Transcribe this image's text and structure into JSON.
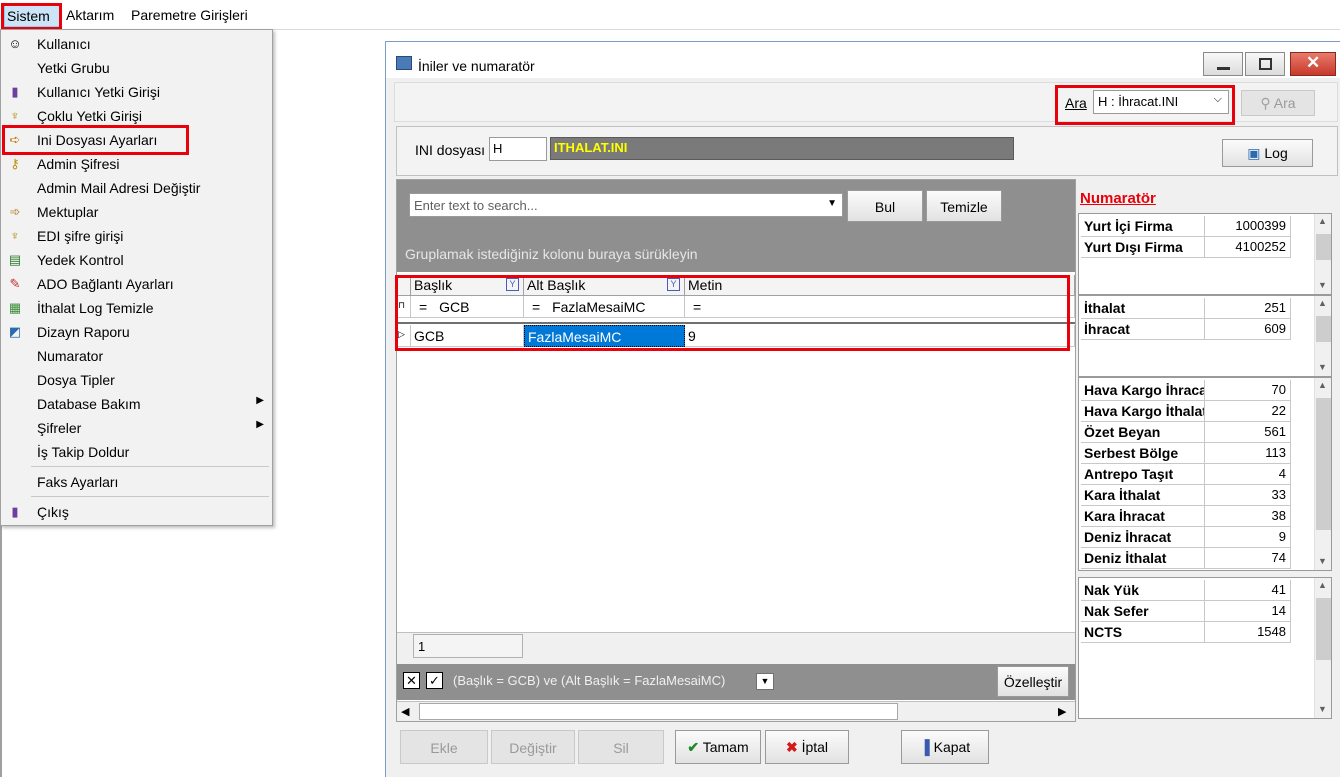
{
  "menubar": {
    "items": [
      "Sistem",
      "Aktarım",
      "Paremetre Girişleri"
    ]
  },
  "sistem_menu": {
    "items": [
      {
        "label": "Kullanıcı",
        "icon": "user-icon"
      },
      {
        "label": "Yetki Grubu",
        "icon": ""
      },
      {
        "label": "Kullanıcı Yetki Girişi",
        "icon": "key-icon"
      },
      {
        "label": "Çoklu Yetki Girişi",
        "icon": "keys-icon"
      },
      {
        "label": "Ini Dosyası  Ayarları",
        "icon": "settings-file-icon"
      },
      {
        "label": "Admin Şifresi",
        "icon": "key-icon"
      },
      {
        "label": "Admin Mail Adresi Değiştir",
        "icon": ""
      },
      {
        "label": "Mektuplar",
        "icon": "letter-icon"
      },
      {
        "label": "EDI şifre girişi",
        "icon": "keys-icon"
      },
      {
        "label": "Yedek Kontrol",
        "icon": "backup-icon"
      },
      {
        "label": "ADO Bağlantı Ayarları",
        "icon": "connection-icon"
      },
      {
        "label": "İthalat Log Temizle",
        "icon": "log-icon"
      },
      {
        "label": "Dizayn Raporu",
        "icon": "report-icon"
      },
      {
        "label": "Numarator",
        "icon": ""
      },
      {
        "label": "Dosya Tipler",
        "icon": ""
      },
      {
        "label": "Database Bakım",
        "icon": ""
      },
      {
        "label": "Şifreler",
        "icon": ""
      },
      {
        "label": "İş Takip Doldur",
        "icon": ""
      },
      {
        "label": "Faks Ayarları",
        "icon": ""
      },
      {
        "label": "Çıkış",
        "icon": "exit-icon"
      }
    ]
  },
  "window": {
    "title": "İniler ve numaratör",
    "search": {
      "label": "Ara",
      "value": "H : İhracat.INI",
      "button": "Ara"
    },
    "ini": {
      "label": "INI dosyası",
      "code": "H",
      "name": "ITHALAT.INI"
    },
    "log_button": "Log",
    "grid_search": {
      "placeholder": "Enter text to search...",
      "find_button": "Bul",
      "clear_button": "Temizle"
    },
    "group_hint": "Gruplamak istediğiniz kolonu buraya sürükleyin",
    "columns": [
      "Başlık",
      "Alt Başlık",
      "Metin"
    ],
    "filter_row": [
      "GCB",
      "FazlaMesaiMC",
      ""
    ],
    "rows": [
      {
        "baslik": "GCB",
        "alt_baslik": "FazlaMesaiMC",
        "metin": "9"
      }
    ],
    "page_value": "1",
    "filter_text": "(Başlık = GCB) ve (Alt Başlık = FazlaMesaiMC)",
    "customize_button": "Özelleştir",
    "buttons": {
      "add": "Ekle",
      "edit": "Değiştir",
      "delete": "Sil",
      "ok": "Tamam",
      "cancel": "İptal",
      "close": "Kapat"
    }
  },
  "numarator": {
    "title": "Numaratör",
    "groups": [
      [
        {
          "k": "Yurt İçi Firma",
          "v": "1000399"
        },
        {
          "k": "Yurt Dışı Firma",
          "v": "4100252"
        }
      ],
      [
        {
          "k": "İthalat",
          "v": "251"
        },
        {
          "k": "İhracat",
          "v": "609"
        }
      ],
      [
        {
          "k": "Hava Kargo İhracat",
          "v": "70"
        },
        {
          "k": "Hava Kargo İthalat",
          "v": "22"
        },
        {
          "k": "Özet Beyan",
          "v": "561"
        },
        {
          "k": "Serbest Bölge",
          "v": "113"
        },
        {
          "k": "Antrepo Taşıt",
          "v": "4"
        },
        {
          "k": "Kara İthalat",
          "v": "33"
        },
        {
          "k": "Kara İhracat",
          "v": "38"
        },
        {
          "k": "Deniz İhracat",
          "v": "9"
        },
        {
          "k": "Deniz İthalat",
          "v": "74"
        }
      ],
      [
        {
          "k": "Nak Yük",
          "v": "41"
        },
        {
          "k": "Nak Sefer",
          "v": "14"
        },
        {
          "k": "NCTS",
          "v": "1548"
        }
      ]
    ]
  },
  "colors": {
    "highlight": "#e8000b",
    "selection": "#0078d7",
    "yellow_text": "#ffff00"
  }
}
